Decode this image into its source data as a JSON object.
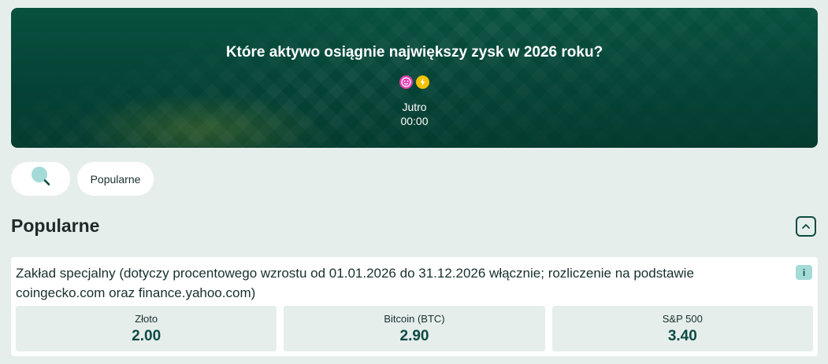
{
  "hero": {
    "title": "Które aktywo osiągnie największy zysk w 2026 roku?",
    "icons": [
      "smile-icon",
      "lightning-icon"
    ],
    "day": "Jutro",
    "time": "00:00"
  },
  "filters": {
    "search_icon": "search-icon",
    "popular_label": "Popularne"
  },
  "section": {
    "title": "Popularne",
    "collapse_icon": "chevron-up-icon"
  },
  "market": {
    "description": "Zakład specjalny (dotyczy procentowego wzrostu od 01.01.2026 do 31.12.2026 włącznie; rozliczenie na podstawie coingecko.com oraz finance.yahoo.com)",
    "info_label": "i",
    "selections": [
      {
        "label": "Złoto",
        "odds": "2.00"
      },
      {
        "label": "Bitcoin (BTC)",
        "odds": "2.90"
      },
      {
        "label": "S&P 500",
        "odds": "3.40"
      }
    ]
  },
  "colors": {
    "hero_bg": "#054336",
    "page_bg": "#e6eeec",
    "accent": "#0b4c40",
    "info_bg": "#a4dbd7"
  }
}
